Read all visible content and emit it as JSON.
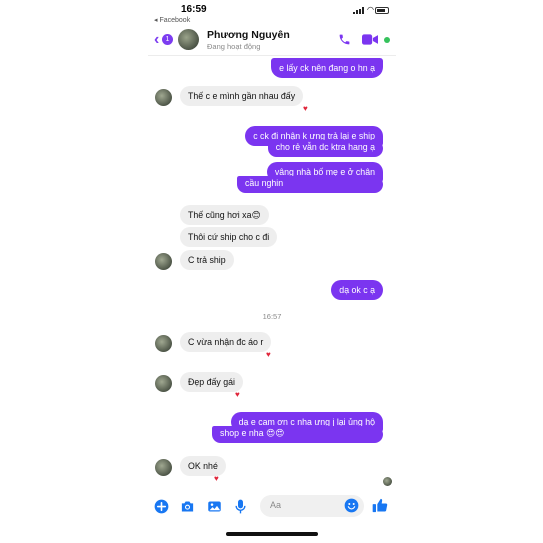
{
  "status_bar": {
    "time": "16:59",
    "back_app": "◂ Facebook"
  },
  "header": {
    "unread_count": "1",
    "contact_name": "Phương Nguyên",
    "contact_status": "Đang hoạt động"
  },
  "colors": {
    "accent": "#7b35f0",
    "incoming_bubble": "#eeeeee",
    "online": "#36c25c",
    "heart": "#e0263b"
  },
  "messages": [
    {
      "dir": "out",
      "text": "e lấy ck nên đang o hn ạ"
    },
    {
      "dir": "in",
      "text": "Thế c e mình gần nhau đấy",
      "reaction": "heart"
    },
    {
      "dir": "out",
      "text": "c ck đi nhận k ưng trả lại e ship"
    },
    {
      "dir": "out",
      "text": "cho rẻ vẫn dc ktra hang ạ"
    },
    {
      "dir": "out",
      "text": "vâng nhà bố mẹ e ở chân"
    },
    {
      "dir": "out",
      "text": "cầu nghin"
    },
    {
      "dir": "in",
      "text": "Thế cũng hơi xa😊"
    },
    {
      "dir": "in",
      "text": "Thôi cứ ship cho c đi"
    },
    {
      "dir": "in",
      "text": "C trả ship"
    },
    {
      "dir": "out",
      "text": "dạ ok c ạ"
    },
    {
      "dir": "in",
      "text": "C vừa nhận đc áo r",
      "reaction": "heart"
    },
    {
      "dir": "in",
      "text": "Đẹp đấy gái",
      "reaction": "heart"
    },
    {
      "dir": "out",
      "text": "dạ e cam ơn c nha ưng j lại ủng hộ"
    },
    {
      "dir": "out",
      "text": "shop e nha 😍😍"
    },
    {
      "dir": "in",
      "text": "OK nhé",
      "reaction": "heart"
    }
  ],
  "time_separator": "16:57",
  "composer": {
    "placeholder": "Aa"
  },
  "icons": {
    "back": "chevron-left-icon",
    "call": "phone-icon",
    "video": "video-camera-icon",
    "plus": "plus-circle-icon",
    "camera": "camera-icon",
    "gallery": "image-icon",
    "mic": "microphone-icon",
    "emoji": "emoji-icon",
    "like": "thumbs-up-icon",
    "reaction": "heart-icon"
  }
}
